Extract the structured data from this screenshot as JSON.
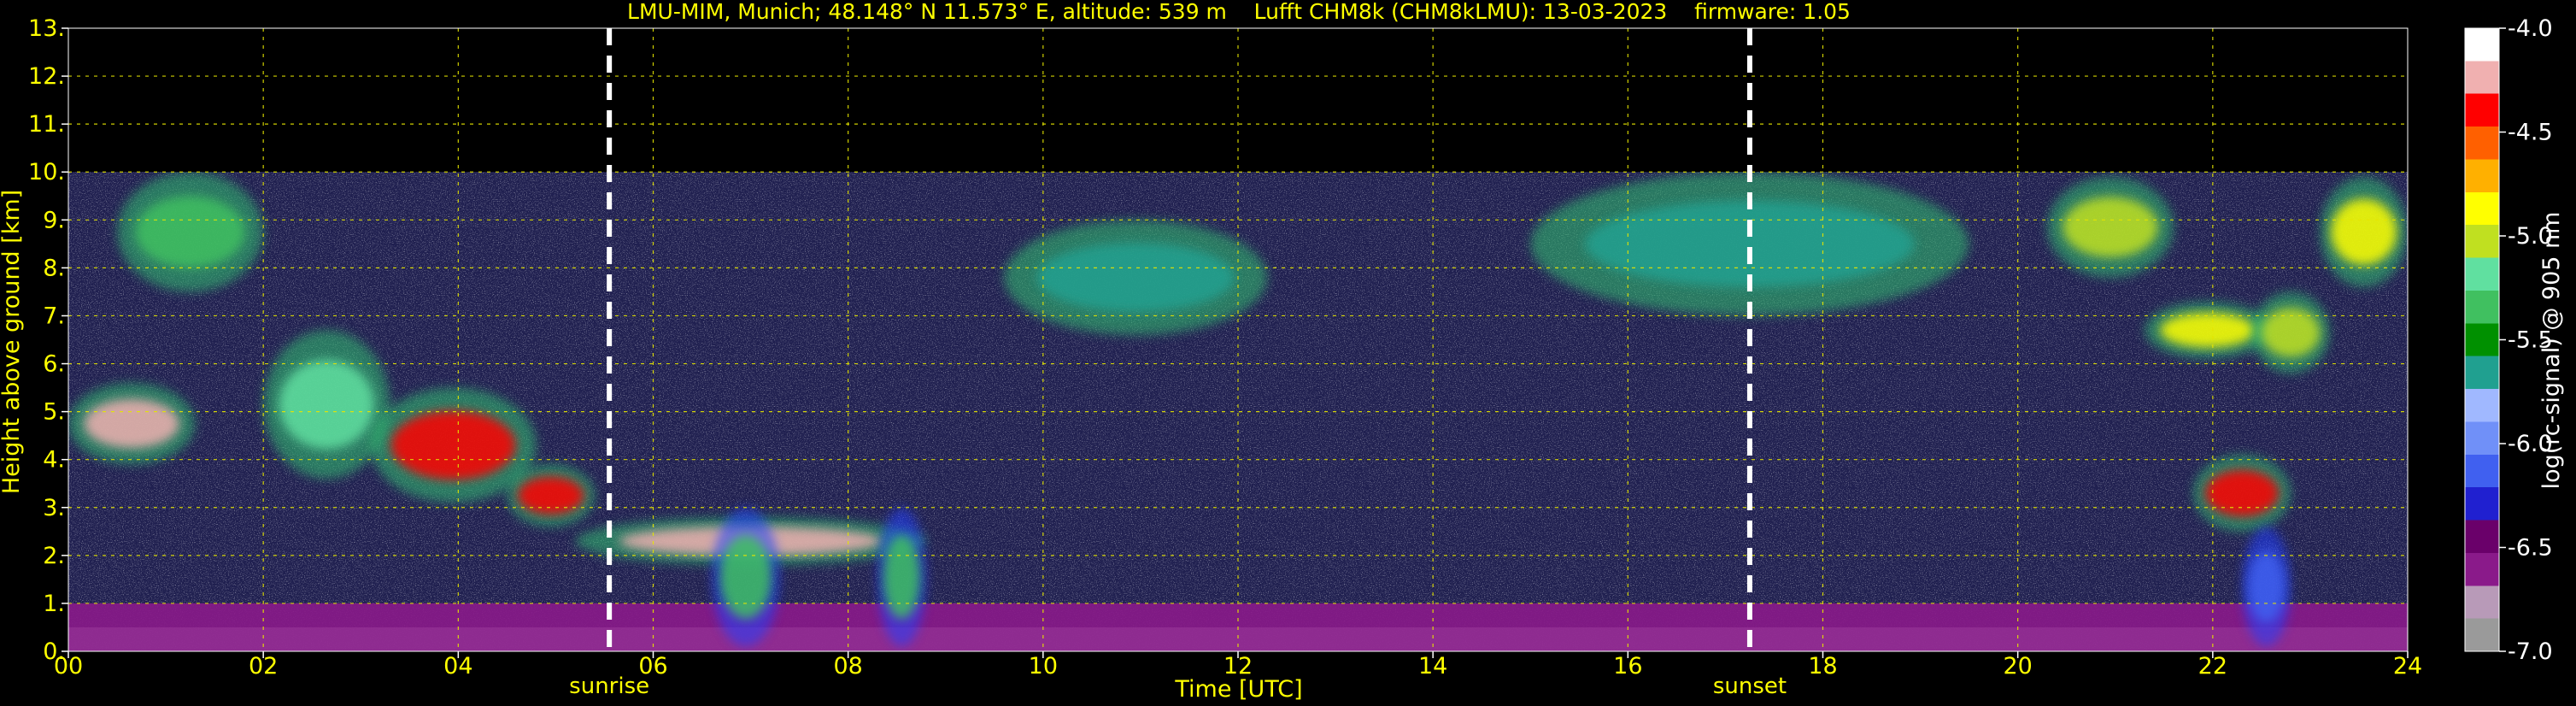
{
  "chart_data": {
    "type": "heatmap",
    "title": "LMU-MIM, Munich; 48.148° N 11.573° E, altitude: 539 m    Lufft CHM8k (CHM8kLMU): 13-03-2023    firmware: 1.05",
    "xlabel": "Time [UTC]",
    "ylabel": "Height above ground [km]",
    "colorbar_label": "log(rc-signal) @ 905 nm",
    "xlim": [
      0,
      24
    ],
    "ylim": [
      0,
      13
    ],
    "xticks": [
      0,
      2,
      4,
      6,
      8,
      10,
      12,
      14,
      16,
      18,
      20,
      22,
      24
    ],
    "xtick_labels": [
      "00",
      "02",
      "04",
      "06",
      "08",
      "10",
      "12",
      "14",
      "16",
      "18",
      "20",
      "22",
      "24"
    ],
    "yticks": [
      0,
      1,
      2,
      3,
      4,
      5,
      6,
      7,
      8,
      9,
      10,
      11,
      12,
      13
    ],
    "ytick_labels": [
      "0.",
      "1.",
      "2.",
      "3.",
      "4.",
      "5.",
      "6.",
      "7.",
      "8.",
      "9.",
      "10.",
      "11.",
      "12.",
      "13."
    ],
    "colorbar_ticks": [
      -7.0,
      -6.5,
      -6.0,
      -5.5,
      -5.0,
      -4.5,
      -4.0
    ],
    "colorbar_tick_labels": [
      "-7.0",
      "-6.5",
      "-6.0",
      "-5.5",
      "-5.0",
      "-4.5",
      "-4.0"
    ],
    "color_range": [
      -7.0,
      -4.0
    ],
    "colormap": [
      "#9a9a9a",
      "#b89ab8",
      "#8a1a8a",
      "#6a006a",
      "#2020d0",
      "#4060f0",
      "#7090f8",
      "#a0b8ff",
      "#20a090",
      "#009000",
      "#40c060",
      "#60e0a0",
      "#c0e020",
      "#ffff00",
      "#ffb000",
      "#ff6000",
      "#ff0000",
      "#f0b0b0",
      "#ffffff"
    ],
    "measurement_range_top": 10.0,
    "grid": true,
    "grid_color": "#e6e600",
    "text_color": "#ffff00",
    "events": [
      {
        "label": "sunrise",
        "time": 5.55
      },
      {
        "label": "sunset",
        "time": 17.25
      }
    ],
    "features": [
      {
        "kind": "boundary_layer",
        "time": [
          0,
          24
        ],
        "base": 0,
        "top": 1.0,
        "level": -6.6
      },
      {
        "kind": "cloud",
        "time": [
          0.0,
          1.3
        ],
        "base": 3.9,
        "top": 5.6,
        "level": -4.2
      },
      {
        "kind": "cloud",
        "time": [
          2.0,
          3.3
        ],
        "base": 3.6,
        "top": 6.7,
        "level": -5.2
      },
      {
        "kind": "cloud",
        "time": [
          3.1,
          4.8
        ],
        "base": 3.1,
        "top": 5.5,
        "level": -4.4
      },
      {
        "kind": "cloud",
        "time": [
          4.5,
          5.4
        ],
        "base": 2.6,
        "top": 3.9,
        "level": -4.3
      },
      {
        "kind": "cloud",
        "time": [
          5.2,
          8.8
        ],
        "base": 1.8,
        "top": 2.8,
        "level": -4.2
      },
      {
        "kind": "precipitation",
        "time": [
          6.6,
          7.3
        ],
        "base": 0.1,
        "top": 3.0,
        "level": -5.3
      },
      {
        "kind": "precipitation",
        "time": [
          8.3,
          8.8
        ],
        "base": 0.1,
        "top": 3.0,
        "level": -5.3
      },
      {
        "kind": "cirrus",
        "time": [
          0.5,
          2.0
        ],
        "base": 7.5,
        "top": 10.0,
        "level": -5.4
      },
      {
        "kind": "cirrus",
        "time": [
          9.6,
          12.3
        ],
        "base": 6.6,
        "top": 9.0,
        "level": -5.6
      },
      {
        "kind": "cirrus",
        "time": [
          15.0,
          19.5
        ],
        "base": 7.0,
        "top": 10.0,
        "level": -5.6
      },
      {
        "kind": "cirrus",
        "time": [
          20.3,
          21.6
        ],
        "base": 7.8,
        "top": 9.9,
        "level": -5.0
      },
      {
        "kind": "cirrus",
        "time": [
          21.3,
          22.6
        ],
        "base": 6.1,
        "top": 7.3,
        "level": -4.9
      },
      {
        "kind": "cirrus",
        "time": [
          22.4,
          23.2
        ],
        "base": 5.8,
        "top": 7.5,
        "level": -5.0
      },
      {
        "kind": "cirrus",
        "time": [
          23.1,
          24.0
        ],
        "base": 7.6,
        "top": 9.9,
        "level": -4.8
      },
      {
        "kind": "cloud",
        "time": [
          21.8,
          22.8
        ],
        "base": 2.5,
        "top": 4.1,
        "level": -4.4
      },
      {
        "kind": "precipitation",
        "time": [
          22.3,
          22.8
        ],
        "base": 0.1,
        "top": 2.6,
        "level": -6.2
      }
    ]
  }
}
